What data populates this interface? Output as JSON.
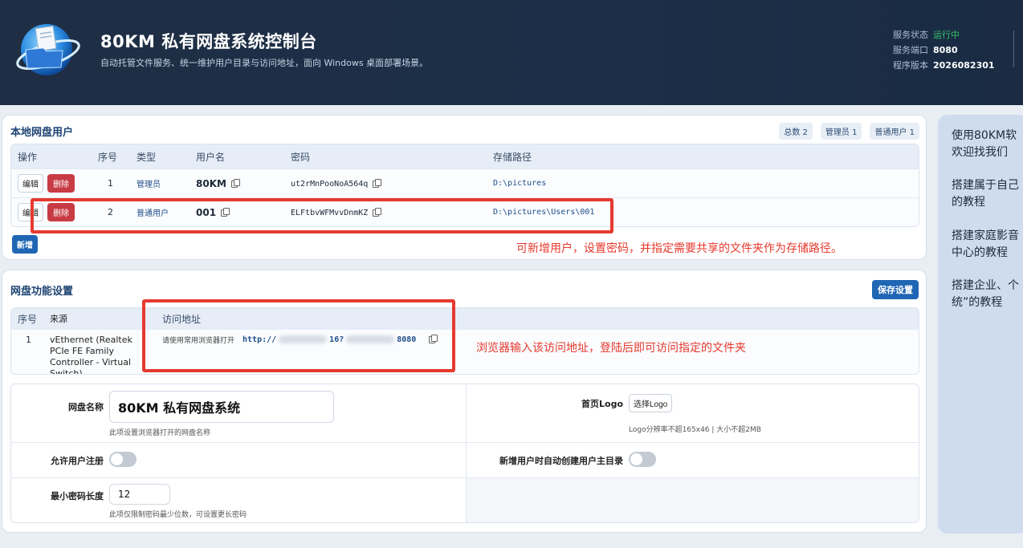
{
  "header": {
    "title": "80KM 私有网盘系统控制台",
    "subtitle": "自动托管文件服务、统一维护用户目录与访问地址，面向 Windows 桌面部署场景。",
    "status": [
      {
        "label": "服务状态",
        "value": "运行中"
      },
      {
        "label": "服务端口",
        "value": "8080"
      },
      {
        "label": "程序版本",
        "value": "2026082301"
      }
    ]
  },
  "users_panel": {
    "title": "本地网盘用户",
    "badges": [
      "总数 2",
      "管理员 1",
      "普通用户 1"
    ],
    "columns": [
      "操作",
      "序号",
      "类型",
      "用户名",
      "密码",
      "存储路径"
    ],
    "edit_label": "编辑",
    "delete_label": "删除",
    "rows": [
      {
        "no": "1",
        "type": "管理员",
        "username": "80KM",
        "password": "ut2rMnPooNoA564q",
        "path": "D:\\pictures"
      },
      {
        "no": "2",
        "type": "普通用户",
        "username": "001",
        "password": "ELFtbvWFMvvDnmKZ",
        "path": "D:\\pictures\\Users\\001"
      }
    ],
    "add_label": "新增",
    "annotation": "可新增用户，设置密码，并指定需要共享的文件夹作为存储路径。"
  },
  "settings_panel": {
    "title": "网盘功能设置",
    "save_label": "保存设置",
    "access_columns": [
      "序号",
      "来源",
      "访问地址"
    ],
    "access_row": {
      "no": "1",
      "source": "vEthernet (Realtek PCIe FE Family Controller - Virtual Switch)",
      "hint": "请使用常用浏览器打开",
      "url_prefix": "http://",
      "url_mid": "16?",
      "url_suffix": "8080"
    },
    "annotation": "浏览器输入该访问地址，登陆后即可访问指定的文件夹",
    "form": {
      "name_label": "网盘名称",
      "name_value": "80KM 私有网盘系统",
      "name_hint": "此项设置浏览器打开的网盘名称",
      "logo_label": "首页Logo",
      "logo_button": "选择Logo",
      "logo_hint": "Logo分辨率不超165x46 | 大小不超2MB",
      "register_label": "允许用户注册",
      "register_on": false,
      "autodir_label": "新增用户时自动创建用户主目录",
      "autodir_on": false,
      "minpwd_label": "最小密码长度",
      "minpwd_value": "12",
      "minpwd_hint": "此项仅限制密码最少位数，可设置更长密码"
    }
  },
  "side_panel": {
    "lines": [
      "使用80KM软",
      "欢迎找我们",
      "搭建属于自己",
      "的教程",
      "搭建家庭影音",
      "中心的教程",
      "搭建企业、个",
      "统”的教程"
    ]
  },
  "colors": {
    "header_bg": "#1f2e44",
    "accent": "#1f66b4",
    "danger": "#c83b44",
    "annotation": "#e53a2f",
    "running": "#35c76b"
  }
}
